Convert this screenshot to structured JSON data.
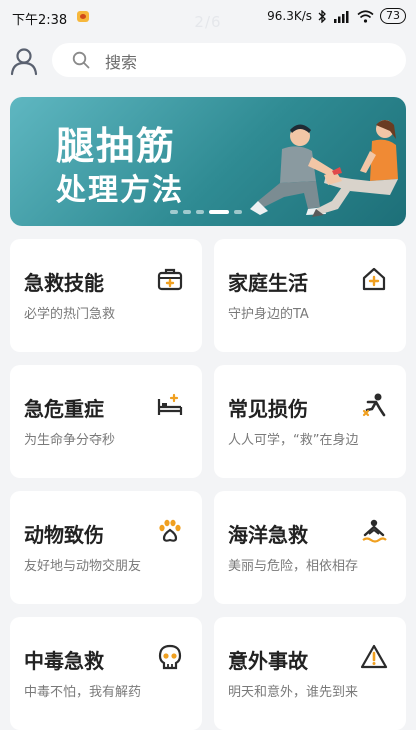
{
  "status_bar": {
    "time": "下午2:38",
    "page_indicator": "2/6",
    "network_speed": "96.3K/s",
    "battery": "73"
  },
  "search": {
    "placeholder": "搜索"
  },
  "banner": {
    "line1": "腿抽筋",
    "line2": "处理方法",
    "slide_count": 5,
    "active_slide": 4
  },
  "cards": [
    {
      "title": "急救技能",
      "subtitle": "必学的热门急救",
      "icon": "first-aid-kit-icon"
    },
    {
      "title": "家庭生活",
      "subtitle": "守护身边的TA",
      "icon": "home-plus-icon"
    },
    {
      "title": "急危重症",
      "subtitle": "为生命争分夺秒",
      "icon": "hospital-bed-icon"
    },
    {
      "title": "常见损伤",
      "subtitle": "人人可学，“救”在身边",
      "icon": "injured-person-icon"
    },
    {
      "title": "动物致伤",
      "subtitle": "友好地与动物交朋友",
      "icon": "paw-icon"
    },
    {
      "title": "海洋急救",
      "subtitle": "美丽与危险，相依相存",
      "icon": "drowning-icon"
    },
    {
      "title": "中毒急救",
      "subtitle": "中毒不怕，我有解药",
      "icon": "skull-icon"
    },
    {
      "title": "意外事故",
      "subtitle": "明天和意外，谁先到来",
      "icon": "warning-icon"
    }
  ],
  "colors": {
    "accent_orange": "#f0a020",
    "icon_dark": "#2b2b2b",
    "banner_teal": "#2f8b93"
  }
}
